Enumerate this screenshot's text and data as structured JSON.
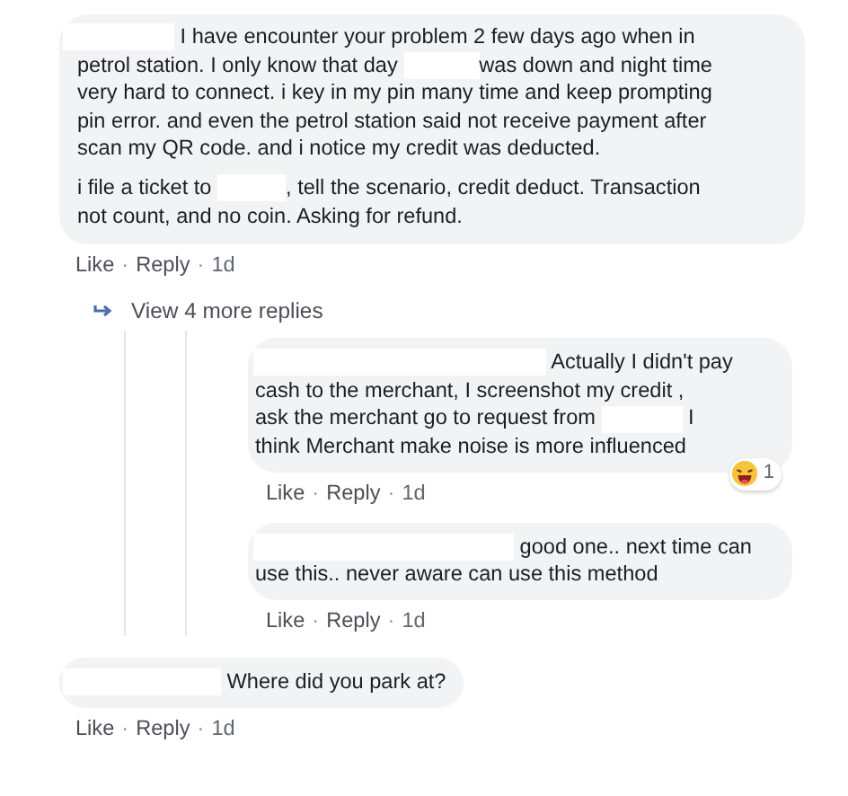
{
  "comments": [
    {
      "body": [
        [
          [
            {
              "kind": "redaction"
            },
            {
              "kind": "text",
              "text": " I have encounter your problem 2 few days ago when in"
            }
          ],
          [
            {
              "kind": "text",
              "text": "petrol station. I only know that day "
            },
            {
              "kind": "redaction"
            },
            {
              "kind": "text",
              "text": "was down and night time"
            }
          ],
          [
            {
              "kind": "text",
              "text": "very hard to connect. i key in my pin many time and keep prompting"
            }
          ],
          [
            {
              "kind": "text",
              "text": "pin error. and even the petrol station said not receive payment after"
            }
          ],
          [
            {
              "kind": "text",
              "text": "scan my QR code. and i notice my credit was deducted."
            }
          ]
        ],
        [
          [
            {
              "kind": "text",
              "text": "i file a ticket to "
            },
            {
              "kind": "redaction"
            },
            {
              "kind": "text",
              "text": ", tell the scenario, credit deduct. Transaction"
            }
          ],
          [
            {
              "kind": "text",
              "text": "not count, and no coin. Asking for refund."
            }
          ]
        ]
      ],
      "actions": [
        {
          "kind": "link",
          "text": "Like"
        },
        {
          "kind": "dot",
          "text": "·"
        },
        {
          "kind": "link",
          "text": "Reply"
        },
        {
          "kind": "dot",
          "text": "·"
        },
        {
          "kind": "time",
          "text": "1d"
        }
      ],
      "more_replies": "View 4 more replies",
      "replies": [
        {
          "body": [
            [
              [
                {
                  "kind": "redaction"
                },
                {
                  "kind": "text",
                  "text": " Actually I didn't pay"
                }
              ],
              [
                {
                  "kind": "text",
                  "text": "cash to the merchant, I screenshot my credit ,"
                }
              ],
              [
                {
                  "kind": "text",
                  "text": "ask the merchant go to request from "
                },
                {
                  "kind": "redaction"
                },
                {
                  "kind": "text",
                  "text": " I"
                }
              ],
              [
                {
                  "kind": "text",
                  "text": "think Merchant make noise is more influenced"
                }
              ]
            ]
          ],
          "reaction": {
            "count": "1"
          },
          "actions": [
            {
              "kind": "link",
              "text": "Like"
            },
            {
              "kind": "dot",
              "text": "·"
            },
            {
              "kind": "link",
              "text": "Reply"
            },
            {
              "kind": "dot",
              "text": "·"
            },
            {
              "kind": "time",
              "text": "1d"
            }
          ]
        },
        {
          "body": [
            [
              [
                {
                  "kind": "redaction"
                },
                {
                  "kind": "text",
                  "text": " good one.. next time can"
                }
              ],
              [
                {
                  "kind": "text",
                  "text": "use this.. never aware can use this method"
                }
              ]
            ]
          ],
          "actions": [
            {
              "kind": "link",
              "text": "Like"
            },
            {
              "kind": "dot",
              "text": "·"
            },
            {
              "kind": "link",
              "text": "Reply"
            },
            {
              "kind": "dot",
              "text": "·"
            },
            {
              "kind": "time",
              "text": "1d"
            }
          ]
        }
      ]
    },
    {
      "body": [
        [
          [
            {
              "kind": "redaction"
            },
            {
              "kind": "text",
              "text": " Where did you park at?"
            }
          ]
        ]
      ],
      "actions": [
        {
          "kind": "link",
          "text": "Like"
        },
        {
          "kind": "dot",
          "text": "·"
        },
        {
          "kind": "link",
          "text": "Reply"
        },
        {
          "kind": "dot",
          "text": "·"
        },
        {
          "kind": "time",
          "text": "1d"
        }
      ]
    }
  ]
}
